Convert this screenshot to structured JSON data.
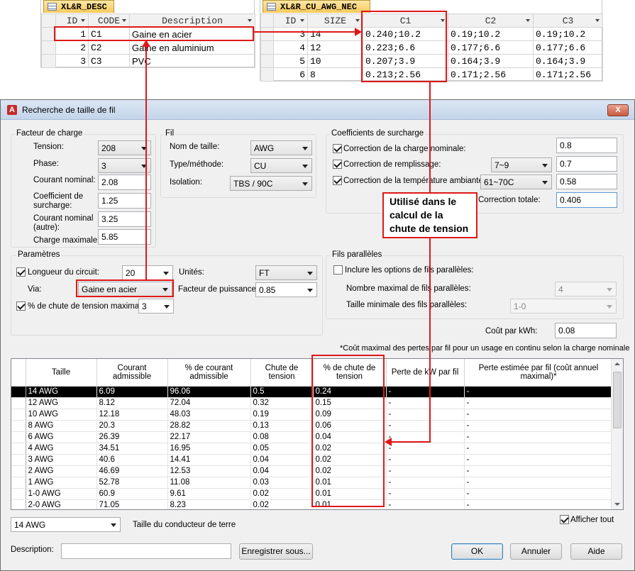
{
  "desc_sheet": {
    "tab": "XL&R_DESC",
    "headers": [
      "ID",
      "CODE",
      "Description"
    ],
    "rows": [
      {
        "id": "1",
        "code": "C1",
        "desc": "Gaine en acier"
      },
      {
        "id": "2",
        "code": "C2",
        "desc": "Gaine en aluminium"
      },
      {
        "id": "3",
        "code": "C3",
        "desc": "PVC"
      }
    ]
  },
  "awg_sheet": {
    "tab": "XL&R_CU_AWG_NEC",
    "headers": [
      "ID",
      "SIZE",
      "C1",
      "C2",
      "C3"
    ],
    "rows": [
      {
        "id": "3",
        "size": "14",
        "c1": "0.240;10.2",
        "c2": "0.19;10.2",
        "c3": "0.19;10.2"
      },
      {
        "id": "4",
        "size": "12",
        "c1": "0.223;6.6",
        "c2": "0.177;6.6",
        "c3": "0.177;6.6"
      },
      {
        "id": "5",
        "size": "10",
        "c1": "0.207;3.9",
        "c2": "0.164;3.9",
        "c3": "0.164;3.9"
      },
      {
        "id": "6",
        "size": "8",
        "c1": "0.213;2.56",
        "c2": "0.171;2.56",
        "c3": "0.171;2.56"
      }
    ]
  },
  "dialog": {
    "title": "Recherche de taille de fil",
    "close_label": "X",
    "app_icon": "autocad-icon",
    "load_factor": {
      "group_label": "Facteur de charge",
      "tension_label": "Tension:",
      "tension_value": "208",
      "phase_label": "Phase:",
      "phase_value": "3",
      "nominal_current_label": "Courant nominal:",
      "nominal_current_value": "2.08",
      "overload_coef_label": "Coefficient de surcharge:",
      "overload_coef_value": "1.25",
      "nominal_current_other_label": "Courant nominal (autre):",
      "nominal_current_other_value": "3.25",
      "max_load_label": "Charge maximale:",
      "max_load_value": "5.85"
    },
    "wire": {
      "group_label": "Fil",
      "size_name_label": "Nom de taille:",
      "size_name_value": "AWG",
      "type_method_label": "Type/méthode:",
      "type_method_value": "CU",
      "insulation_label": "Isolation:",
      "insulation_value": "TBS / 90C"
    },
    "overload_coefs": {
      "group_label": "Coefficients de surcharge",
      "nominal_correction_label": "Correction de la charge nominale:",
      "nominal_correction_value": "0.8",
      "fill_correction_label": "Correction de remplissage:",
      "fill_correction_combo": "7~9",
      "fill_correction_value": "0.7",
      "temp_correction_label": "Correction de la température ambiante:",
      "temp_correction_combo": "61~70C",
      "temp_correction_value": "0.58",
      "total_correction_label": "Correction totale:",
      "total_correction_value": "0.406"
    },
    "params": {
      "group_label": "Paramètres",
      "circuit_length_label": "Longueur du circuit:",
      "circuit_length_value": "20",
      "units_label": "Unités:",
      "units_value": "FT",
      "via_label": "Via:",
      "via_value": "Gaine en acier",
      "power_factor_label": "Facteur de puissance:",
      "power_factor_value": "0.85",
      "max_drop_label": "% de chute de tension maximal:",
      "max_drop_value": "3"
    },
    "parallel": {
      "group_label": "Fils parallèles",
      "include_label": "Inclure les options de fils parallèles:",
      "max_count_label": "Nombre maximal de fils parallèles:",
      "max_count_value": "4",
      "min_size_label": "Taille minimale des fils parallèles:",
      "min_size_value": "1-0"
    },
    "cost_label": "Coût par kWh:",
    "cost_value": "0.08",
    "footnote": "*Coût maximal des pertes par fil pour un usage en continu selon la charge nominale",
    "grid": {
      "headers": [
        "Taille",
        "Courant admissible",
        "% de courant admissible",
        "Chute de tension",
        "% de chute de tension",
        "Perte de kW par fil",
        "Perte estimée par fil (coût annuel maximal)*"
      ],
      "rows": [
        [
          "14 AWG",
          "6.09",
          "96.06",
          "0.5",
          "0.24",
          "-",
          "-"
        ],
        [
          "12 AWG",
          "8.12",
          "72.04",
          "0.32",
          "0.15",
          "-",
          "-"
        ],
        [
          "10 AWG",
          "12.18",
          "48.03",
          "0.19",
          "0.09",
          "-",
          "-"
        ],
        [
          "8 AWG",
          "20.3",
          "28.82",
          "0.13",
          "0.06",
          "-",
          "-"
        ],
        [
          "6 AWG",
          "26.39",
          "22.17",
          "0.08",
          "0.04",
          "-",
          "-"
        ],
        [
          "4 AWG",
          "34.51",
          "16.95",
          "0.05",
          "0.02",
          "-",
          "-"
        ],
        [
          "3 AWG",
          "40.6",
          "14.41",
          "0.04",
          "0.02",
          "-",
          "-"
        ],
        [
          "2 AWG",
          "46.69",
          "12.53",
          "0.04",
          "0.02",
          "-",
          "-"
        ],
        [
          "1 AWG",
          "52.78",
          "11.08",
          "0.03",
          "0.01",
          "-",
          "-"
        ],
        [
          "1-0 AWG",
          "60.9",
          "9.61",
          "0.02",
          "0.01",
          "-",
          "-"
        ],
        [
          "2-0 AWG",
          "71.05",
          "8.23",
          "0.02",
          "0.01",
          "-",
          "-"
        ]
      ]
    },
    "ground_size_value": "14 AWG",
    "ground_size_label": "Taille du conducteur de terre",
    "show_all_label": "Afficher tout",
    "description_label": "Description:",
    "description_value": "",
    "save_as_label": "Enregistrer sous...",
    "ok_label": "OK",
    "cancel_label": "Annuler",
    "help_label": "Aide"
  },
  "annotation": {
    "callout": "Utilisé dans le calcul de la chute de tension"
  }
}
